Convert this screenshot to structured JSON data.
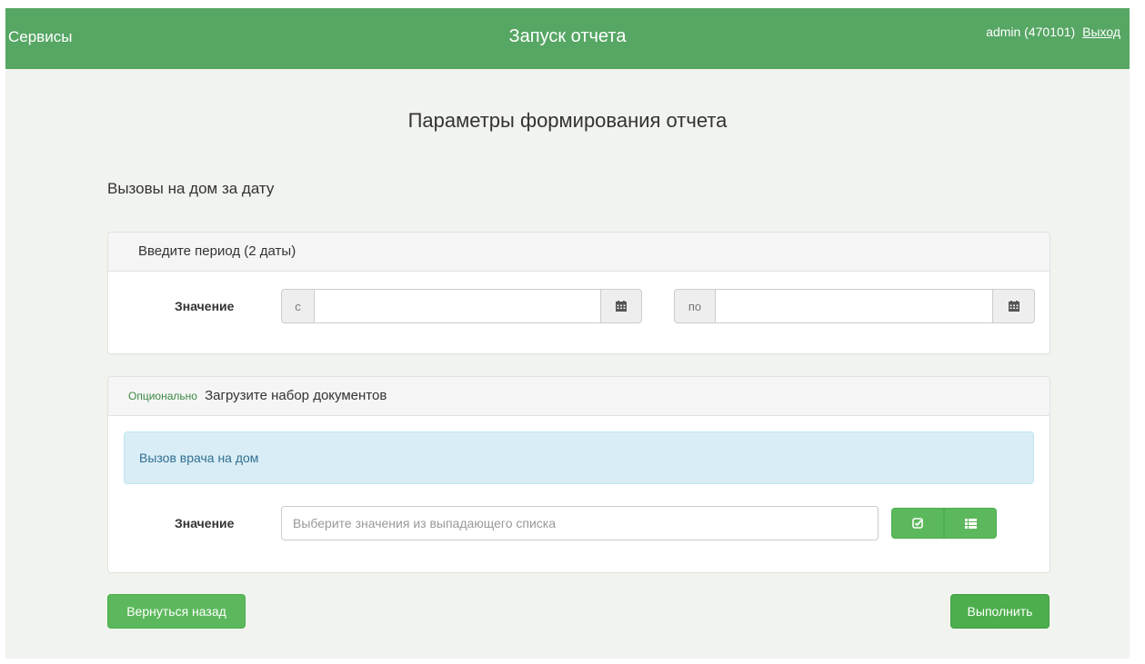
{
  "header": {
    "services": "Сервисы",
    "title": "Запуск отчета",
    "user": "admin (470101)",
    "logout": "Выход"
  },
  "page_title": "Параметры формирования отчета",
  "report_name": "Вызовы на дом за дату",
  "period_panel": {
    "heading": "Введите период (2 даты)",
    "value_label": "Значение",
    "from_label": "с",
    "to_label": "по",
    "from_value": "",
    "to_value": ""
  },
  "documents_panel": {
    "optional": "Опционально",
    "heading": "Загрузите набор документов",
    "info": "Вызов врача на дом",
    "value_label": "Значение",
    "placeholder": "Выберите значения из выпадающего списка"
  },
  "buttons": {
    "back": "Вернуться назад",
    "run": "Выполнить"
  },
  "colors": {
    "header": "#56a664",
    "button": "#5cb85c",
    "info_bg": "#d9edf7"
  }
}
